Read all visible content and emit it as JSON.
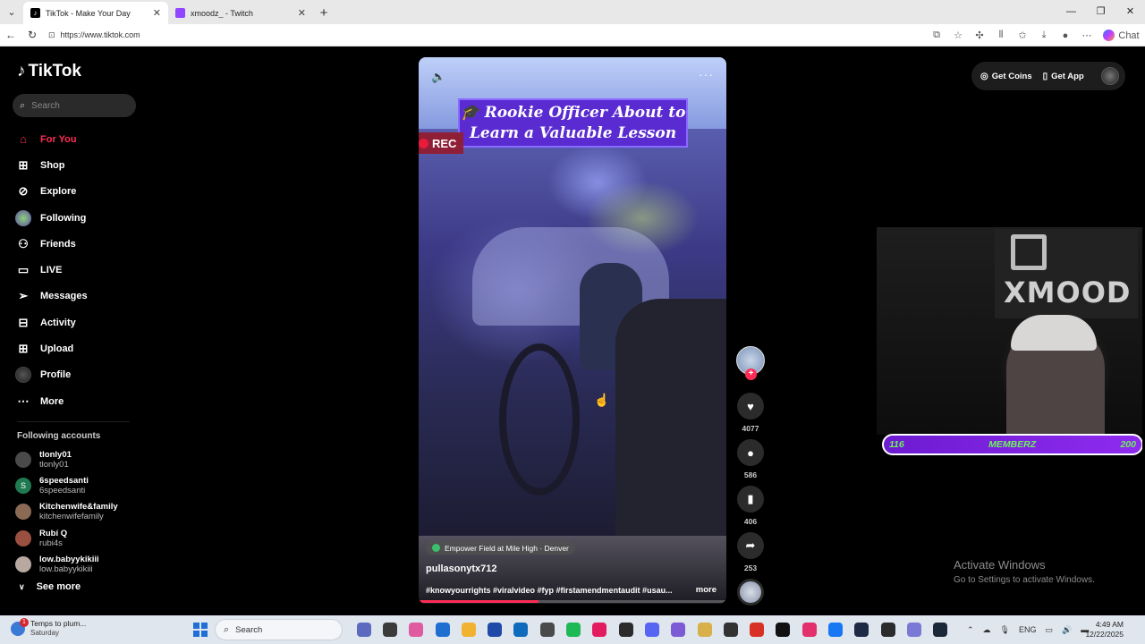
{
  "browser": {
    "tabs": [
      {
        "title": "TikTok - Make Your Day",
        "active": true
      },
      {
        "title": "xmoodz_ - Twitch",
        "active": false
      }
    ],
    "url": "https://www.tiktok.com",
    "chat_label": "Chat"
  },
  "sidebar": {
    "logo_text": "TikTok",
    "search_placeholder": "Search",
    "nav": [
      {
        "label": "For You",
        "icon": "home-icon"
      },
      {
        "label": "Shop",
        "icon": "shop-bag-icon"
      },
      {
        "label": "Explore",
        "icon": "compass-icon"
      },
      {
        "label": "Following",
        "icon": "following-avatar-icon"
      },
      {
        "label": "Friends",
        "icon": "friends-icon"
      },
      {
        "label": "LIVE",
        "icon": "live-tv-icon"
      },
      {
        "label": "Messages",
        "icon": "paper-plane-icon"
      },
      {
        "label": "Activity",
        "icon": "inbox-icon"
      },
      {
        "label": "Upload",
        "icon": "plus-square-icon"
      },
      {
        "label": "Profile",
        "icon": "profile-avatar-icon"
      },
      {
        "label": "More",
        "icon": "ellipsis-icon"
      }
    ],
    "following_title": "Following accounts",
    "following": [
      {
        "name": "tlonly01",
        "handle": "tlonly01",
        "color": "#4a4a4a",
        "initial": ""
      },
      {
        "name": "6speedsanti",
        "handle": "6speedsanti",
        "color": "#1f7a52",
        "initial": "S"
      },
      {
        "name": "Kitchenwife&family",
        "handle": "kitchenwifefamily",
        "color": "#8a6a55",
        "initial": ""
      },
      {
        "name": "Rubí Q",
        "handle": "rubi4s",
        "color": "#9a5040",
        "initial": ""
      },
      {
        "name": "low.babyykikiii",
        "handle": "low.babyykikiii",
        "color": "#b8a9a0",
        "initial": ""
      }
    ],
    "see_more": "See more"
  },
  "video": {
    "caption_line1": "🎓 Rookie Officer About to",
    "caption_line2": "Learn a Valuable Lesson",
    "rec_label": "REC",
    "location": "Empower Field at Mile High · Denver",
    "author": "pullasonytx712",
    "description": "#knowyourrights #viralvideo #fyp #firstamendmentaudit #usau...",
    "more_label": "more",
    "progress": 0.39
  },
  "actions": {
    "likes": "4077",
    "comments": "586",
    "saves": "406",
    "shares": "253"
  },
  "topright": {
    "coins_label": "Get Coins",
    "app_label": "Get App"
  },
  "stream": {
    "channel_name": "XMOOD",
    "bar_left": "116",
    "bar_center": "MEMBERZ",
    "bar_right": "200"
  },
  "watermark": {
    "line1": "Activate Windows",
    "line2": "Go to Settings to activate Windows."
  },
  "taskbar": {
    "weather_line1": "Temps to plum...",
    "weather_line2": "Saturday",
    "weather_badge": "1",
    "search_label": "Search",
    "lang": "ENG",
    "time": "4:49 AM",
    "date": "12/22/2025",
    "apps": [
      "#5c6bc0",
      "#3b3b3b",
      "#e05aa0",
      "#1e6fd0",
      "#f2b231",
      "#1f4aa8",
      "#0f6cbd",
      "#4a4a4a",
      "#1db954",
      "#e31c5f",
      "#2b2b2b",
      "#5865f2",
      "#7b5bd6",
      "#d8b04a",
      "#333333",
      "#d93025",
      "#111111",
      "#e1306c",
      "#1877f2",
      "#1f2a44",
      "#2b2b2b",
      "#7a7ad6",
      "#1b2838"
    ]
  }
}
